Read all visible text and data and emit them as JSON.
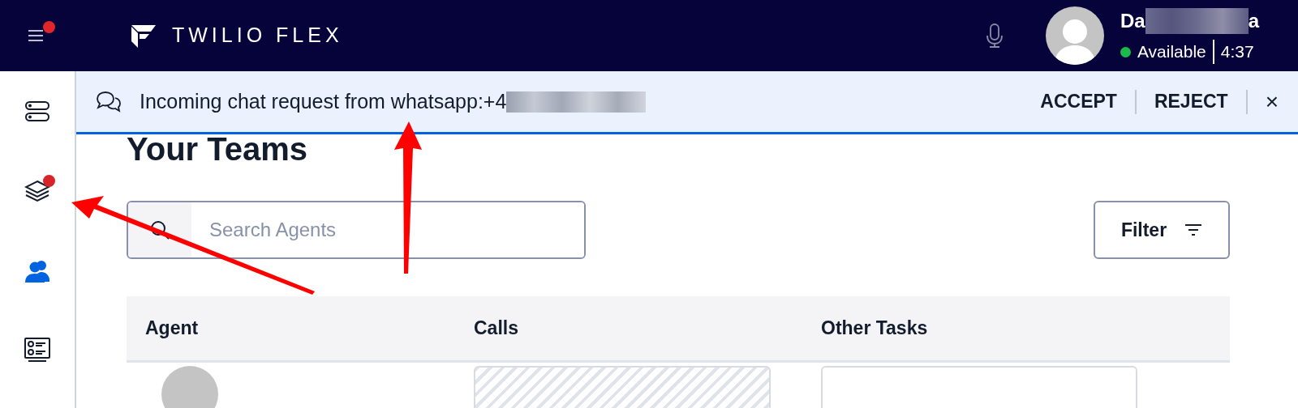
{
  "header": {
    "menu_badge": true,
    "logo_text": "TWILIO FLEX",
    "user": {
      "name_start": "Da",
      "name_end": "a",
      "status": "Available",
      "timer": "4:37"
    }
  },
  "sidebar": {
    "items": [
      {
        "badge": false,
        "selected": false
      },
      {
        "badge": true,
        "selected": false
      },
      {
        "badge": false,
        "selected": true
      },
      {
        "badge": false,
        "selected": false
      }
    ]
  },
  "notification": {
    "message": "Incoming chat request from whatsapp:+4",
    "actions": [
      "ACCEPT",
      "REJECT"
    ],
    "close": "×"
  },
  "page": {
    "title": "Your Teams",
    "search": {
      "placeholder": "Search Agents"
    },
    "filter": "Filter",
    "table": {
      "columns": [
        "Agent",
        "Calls",
        "Other Tasks"
      ]
    }
  }
}
